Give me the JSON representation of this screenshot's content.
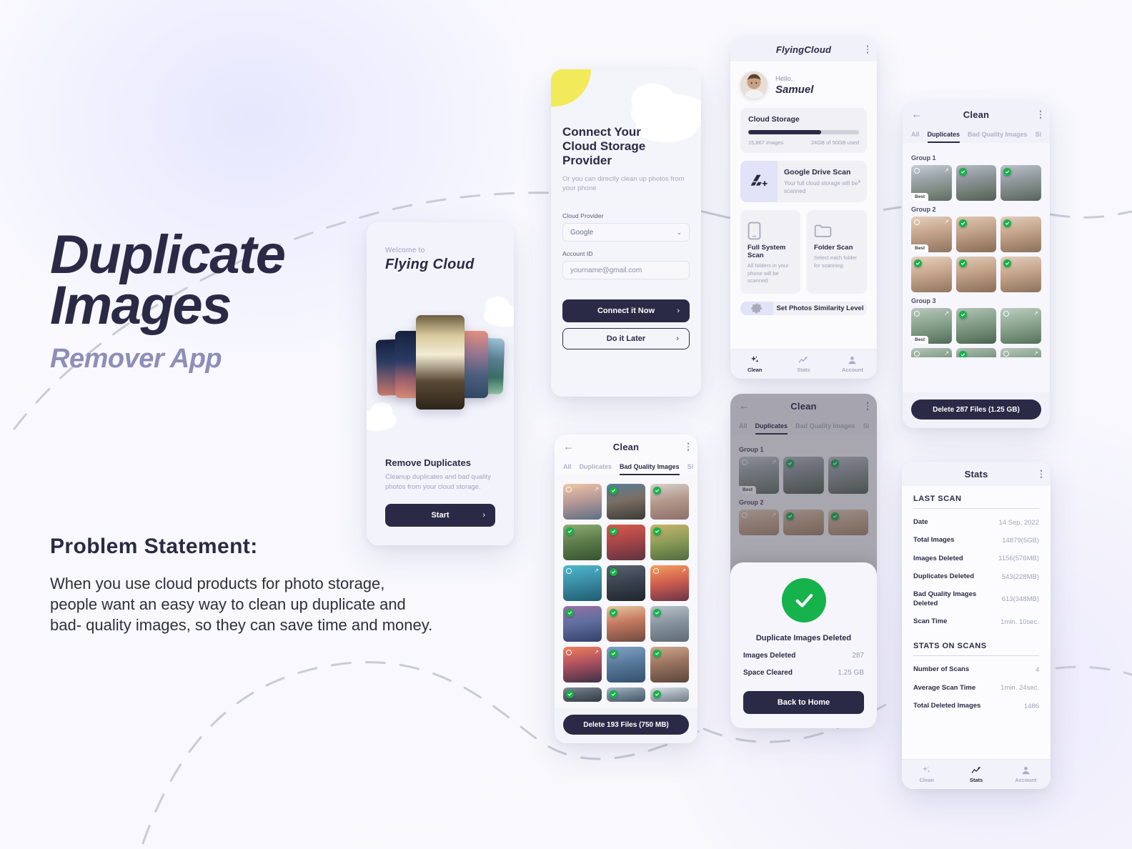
{
  "hero": {
    "title_line1": "Duplicate",
    "title_line2": "Images",
    "subtitle": "Remover App"
  },
  "problem": {
    "heading": "Problem Statement:",
    "line1": "When you use cloud products for photo storage,",
    "line2": "people want an easy way to clean up duplicate and",
    "line3": "bad- quality images, so they can save time and money."
  },
  "welcome_screen": {
    "eyebrow": "Welcome to",
    "brand": "Flying Cloud",
    "heading": "Remove Duplicates",
    "description": "Cleanup duplicates and bad quality photos from your cloud storage.",
    "start_label": "Start",
    "chevron": "›"
  },
  "connect_screen": {
    "title_line1": "Connect Your",
    "title_line2": "Cloud Storage",
    "title_line3": "Provider",
    "subtitle": "Or you can directly clean up photos from your phone",
    "provider_label": "Cloud Provider",
    "provider_value": "Google",
    "provider_caret": "⌄",
    "account_label": "Account ID",
    "account_placeholder": "yourname@gmail.com",
    "primary_button": "Connect it Now",
    "secondary_button": "Do it Later",
    "chevron": "›"
  },
  "home_screen": {
    "app_title": "FlyingCloud",
    "hello": "Hello,",
    "name": "Samuel",
    "storage": {
      "title": "Cloud Storage",
      "images_count": "15,867 images",
      "used_text": "24GB of 50GB used",
      "percent_used": 66
    },
    "drive_tile": {
      "title": "Google Drive Scan",
      "description": "Your full cloud storage will be scanned",
      "chevron": "›"
    },
    "scan_tiles": [
      {
        "title": "Full System Scan",
        "description": "All folders in your phone will be scanned"
      },
      {
        "title": "Folder Scan",
        "description": "Select each folder for scanning"
      }
    ],
    "similarity_tile": "Set Photos Similarity Level",
    "nav": [
      {
        "label": "Clean",
        "icon": "sparkle-icon",
        "active": true
      },
      {
        "label": "Stats",
        "icon": "chart-icon",
        "active": false
      },
      {
        "label": "Account",
        "icon": "person-icon",
        "active": false
      }
    ]
  },
  "duplicates_screen": {
    "title": "Clean",
    "tabs": [
      "All",
      "Duplicates",
      "Bad Quality Images",
      "Si"
    ],
    "active_tab": "Duplicates",
    "groups": [
      {
        "label": "Group 1"
      },
      {
        "label": "Group 2"
      },
      {
        "label": "Group 3"
      }
    ],
    "best_badge": "Best",
    "delete_button": "Delete 287 Files (1.25 GB)"
  },
  "badquality_screen": {
    "title": "Clean",
    "tabs": [
      "All",
      "Duplicates",
      "Bad Quality Images",
      "Si"
    ],
    "active_tab": "Bad Quality Images",
    "delete_button": "Delete 193 Files (750 MB)"
  },
  "done_screen": {
    "title": "Clean",
    "tabs": [
      "All",
      "Duplicates",
      "Bad Quality Images",
      "Si"
    ],
    "active_tab": "Duplicates",
    "groups": [
      {
        "label": "Group 1"
      },
      {
        "label": "Group 2"
      }
    ],
    "best_badge": "Best",
    "modal": {
      "heading": "Duplicate Images Deleted",
      "rows": [
        {
          "key": "Images Deleted",
          "value": "287"
        },
        {
          "key": "Space Cleared",
          "value": "1.25 GB"
        }
      ],
      "button": "Back to Home"
    }
  },
  "stats_screen": {
    "title": "Stats",
    "section1": "LAST SCAN",
    "section1_rows": [
      {
        "key": "Date",
        "value": "14 Sep, 2022"
      },
      {
        "key": "Total Images",
        "value": "14879(5GB)"
      },
      {
        "key": "Images Deleted",
        "value": "1156(576MB)"
      },
      {
        "key": "Duplicates Deleted",
        "value": "543(228MB)"
      },
      {
        "key": "Bad Quality Images Deleted",
        "value": "613(348MB)"
      },
      {
        "key": "Scan Time",
        "value": "1min. 10sec."
      }
    ],
    "section2": "STATS ON SCANS",
    "section2_rows": [
      {
        "key": "Number of Scans",
        "value": "4"
      },
      {
        "key": "Average Scan Time",
        "value": "1min. 24sec."
      },
      {
        "key": "Total Deleted Images",
        "value": "1486"
      }
    ],
    "nav": [
      {
        "label": "Clean",
        "icon": "sparkle-icon",
        "active": false
      },
      {
        "label": "Stats",
        "icon": "chart-icon",
        "active": true
      },
      {
        "label": "Account",
        "icon": "person-icon",
        "active": false
      }
    ]
  },
  "colors": {
    "ink": "#2b2a46",
    "muted": "#a0a2b8",
    "accent_lavender": "#e2e2f8",
    "success_green": "#16b24b",
    "accent_yellow": "#f2ea5a"
  }
}
